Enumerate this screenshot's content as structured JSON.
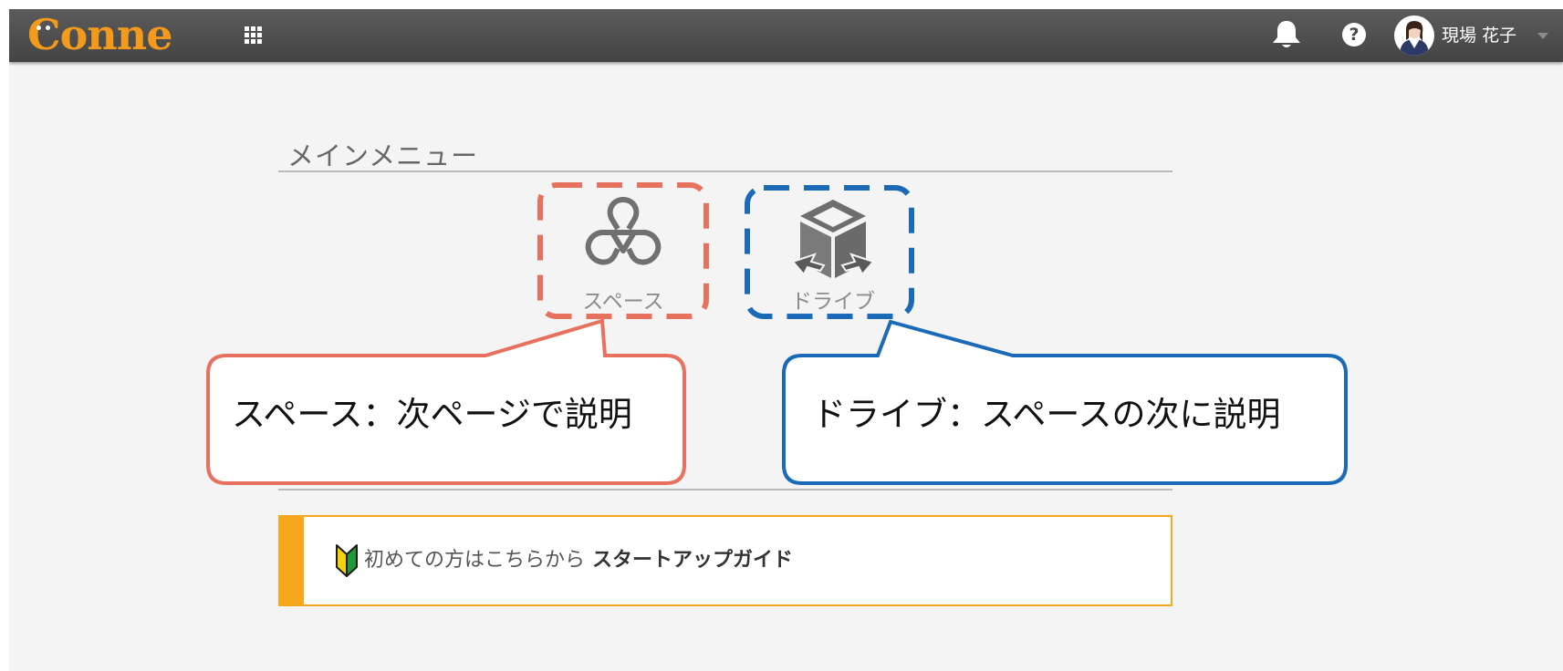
{
  "header": {
    "logo_text": "onne",
    "apps_icon": "grid-icon",
    "notifications_icon": "bell-icon",
    "help_label": "?",
    "user_name": "現場 花子",
    "colors": {
      "bar": "#4c4c4c",
      "logo": "#f39a1c"
    }
  },
  "main": {
    "section_title": "メインメニュー",
    "tiles": [
      {
        "label": "スペース",
        "icon": "space-icon"
      },
      {
        "label": "ドライブ",
        "icon": "drive-icon"
      }
    ]
  },
  "annotations": [
    {
      "text": "スペース：次ページで説明",
      "color": "#e8705e"
    },
    {
      "text": "ドライブ：スペースの次に説明",
      "color": "#1a6ab8"
    }
  ],
  "guide_banner": {
    "intro": "初めての方はこちらから",
    "link": "スタートアップガイド",
    "icon": "beginner-leaf-icon",
    "accent_color": "#f7a71b"
  }
}
